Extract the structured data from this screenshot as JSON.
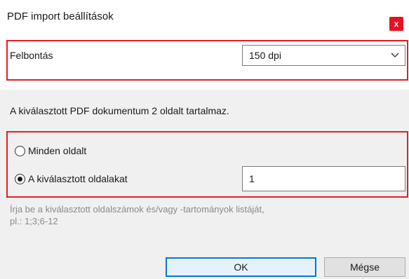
{
  "window": {
    "title": "PDF import beállítások",
    "close_glyph": "x"
  },
  "resolution": {
    "label": "Felbontás",
    "selected": "150 dpi"
  },
  "info_text": "A kiválasztott PDF dokumentum 2 oldalt tartalmaz.",
  "pages": {
    "all_label": "Minden oldalt",
    "all_checked": false,
    "selected_label": "A kiválasztott oldalakat",
    "selected_checked": true,
    "selected_value": "1"
  },
  "hint": {
    "line1": "Írja be a kiválasztott oldalszámok és/vagy -tartományok listáját,",
    "line2": "pl.: 1;3;6-12"
  },
  "buttons": {
    "ok": "OK",
    "cancel": "Mégse"
  },
  "colors": {
    "highlight": "#e51c23",
    "close": "#e81123",
    "primary_border": "#0078d7"
  }
}
